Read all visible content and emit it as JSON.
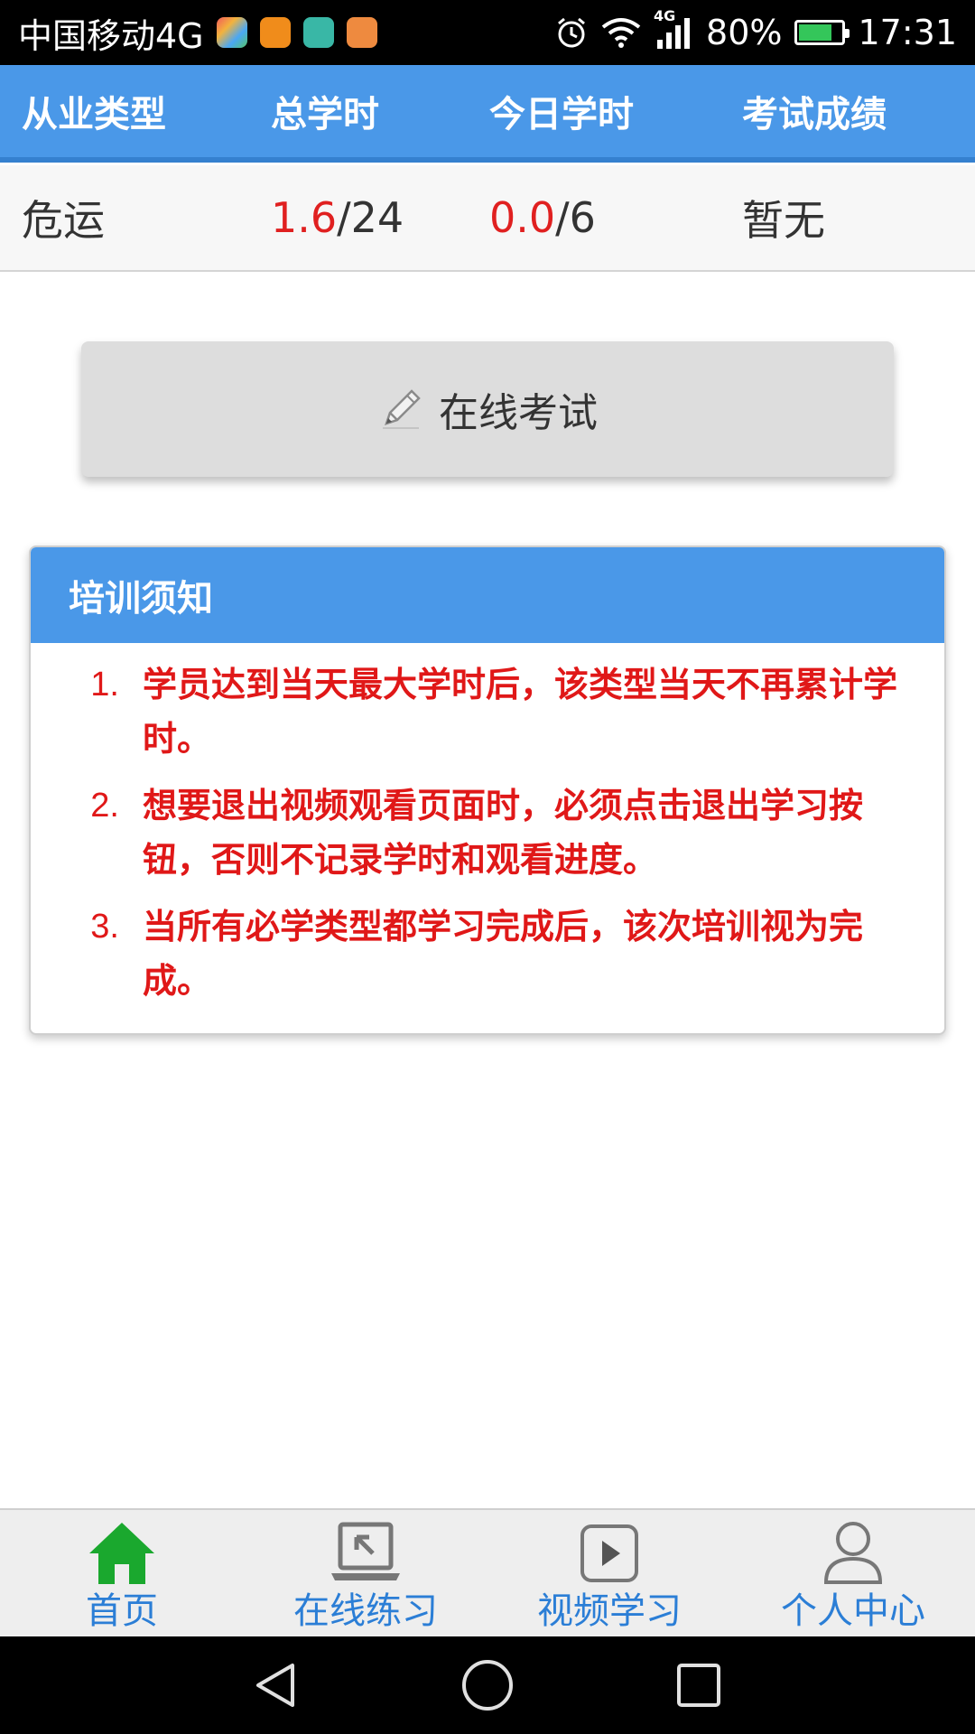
{
  "status_bar": {
    "carrier": "中国移动4G",
    "network_label": "4G",
    "battery_percent": "80%",
    "battery_level": 0.8,
    "time": "17:31"
  },
  "table": {
    "headers": [
      "从业类型",
      "总学时",
      "今日学时",
      "考试成绩"
    ],
    "row": {
      "type": "危运",
      "total_done": "1.6",
      "total_required": "/24",
      "today_done": "0.0",
      "today_required": "/6",
      "score": "暂无"
    }
  },
  "exam_button": {
    "label": "在线考试",
    "icon": "pencil-icon"
  },
  "notice": {
    "title": "培训须知",
    "items": [
      {
        "num": "1.",
        "text": "学员达到当天最大学时后，该类型当天不再累计学时。"
      },
      {
        "num": "2.",
        "text": "想要退出视频观看页面时，必须点击退出学习按钮，否则不记录学时和观看进度。"
      },
      {
        "num": "3.",
        "text": "当所有必学类型都学习完成后，该次培训视为完成。"
      }
    ]
  },
  "bottom_nav": {
    "items": [
      {
        "label": "首页",
        "icon": "home-icon",
        "active": true
      },
      {
        "label": "在线练习",
        "icon": "laptop-icon",
        "active": false
      },
      {
        "label": "视频学习",
        "icon": "play-icon",
        "active": false
      },
      {
        "label": "个人中心",
        "icon": "person-icon",
        "active": false
      }
    ]
  },
  "colors": {
    "primary": "#4a98e8",
    "highlight_red": "#e02020",
    "home_active": "#1aa82e",
    "nav_text": "#2b7ed6"
  }
}
